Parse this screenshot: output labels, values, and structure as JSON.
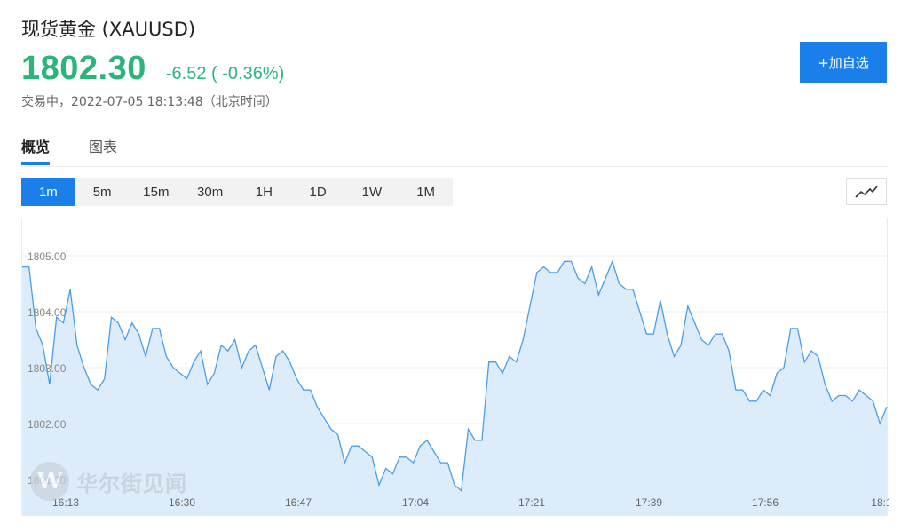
{
  "header": {
    "title": "现货黄金 (XAUUSD)",
    "price": "1802.30",
    "change": "-6.52 ( -0.36%)",
    "status": "交易中，2022-07-05 18:13:48（北京时间）",
    "add_label": "+加自选"
  },
  "tabs": [
    {
      "label": "概览",
      "active": true
    },
    {
      "label": "图表",
      "active": false
    }
  ],
  "periods": [
    {
      "label": "1m",
      "active": true
    },
    {
      "label": "5m",
      "active": false
    },
    {
      "label": "15m",
      "active": false
    },
    {
      "label": "30m",
      "active": false
    },
    {
      "label": "1H",
      "active": false
    },
    {
      "label": "1D",
      "active": false
    },
    {
      "label": "1W",
      "active": false
    },
    {
      "label": "1M",
      "active": false
    }
  ],
  "chart_type_icon": "line-chart-icon",
  "watermark": {
    "logo": "W",
    "text": "华尔街见闻"
  },
  "colors": {
    "up_down": "#2bb57a",
    "accent": "#1a7fe8",
    "line": "#4a9ee8",
    "fill": "#dcecfb"
  },
  "chart_data": {
    "type": "area",
    "ylim": [
      1800.6,
      1805.2
    ],
    "yticks": [
      "1801.00",
      "1802.00",
      "1803.00",
      "1804.00",
      "1805.00"
    ],
    "xticks": [
      "16:13",
      "16:30",
      "16:47",
      "17:04",
      "17:21",
      "17:39",
      "17:56",
      "18:1"
    ],
    "values": [
      1804.8,
      1804.8,
      1803.7,
      1803.4,
      1802.7,
      1803.9,
      1803.8,
      1804.4,
      1803.4,
      1803.0,
      1802.7,
      1802.6,
      1802.8,
      1803.9,
      1803.8,
      1803.5,
      1803.8,
      1803.6,
      1803.2,
      1803.7,
      1803.7,
      1803.2,
      1803.0,
      1802.9,
      1802.8,
      1803.1,
      1803.3,
      1802.7,
      1802.9,
      1803.4,
      1803.3,
      1803.5,
      1803.0,
      1803.3,
      1803.4,
      1803.0,
      1802.6,
      1803.2,
      1803.3,
      1803.1,
      1802.8,
      1802.6,
      1802.6,
      1802.3,
      1802.1,
      1801.9,
      1801.8,
      1801.3,
      1801.6,
      1801.6,
      1801.5,
      1801.4,
      1800.9,
      1801.2,
      1801.1,
      1801.4,
      1801.4,
      1801.3,
      1801.6,
      1801.7,
      1801.5,
      1801.3,
      1801.3,
      1800.9,
      1800.8,
      1801.9,
      1801.7,
      1801.7,
      1803.1,
      1803.1,
      1802.9,
      1803.2,
      1803.1,
      1803.5,
      1804.1,
      1804.7,
      1804.8,
      1804.7,
      1804.7,
      1804.9,
      1804.9,
      1804.6,
      1804.5,
      1804.8,
      1804.3,
      1804.6,
      1804.9,
      1804.5,
      1804.4,
      1804.4,
      1804.0,
      1803.6,
      1803.6,
      1804.2,
      1803.6,
      1803.2,
      1803.4,
      1804.1,
      1803.8,
      1803.5,
      1803.4,
      1803.6,
      1803.6,
      1803.3,
      1802.6,
      1802.6,
      1802.4,
      1802.4,
      1802.6,
      1802.5,
      1802.9,
      1803.0,
      1803.7,
      1803.7,
      1803.1,
      1803.3,
      1803.2,
      1802.7,
      1802.4,
      1802.5,
      1802.5,
      1802.4,
      1802.6,
      1802.5,
      1802.4,
      1802.0,
      1802.3
    ]
  }
}
